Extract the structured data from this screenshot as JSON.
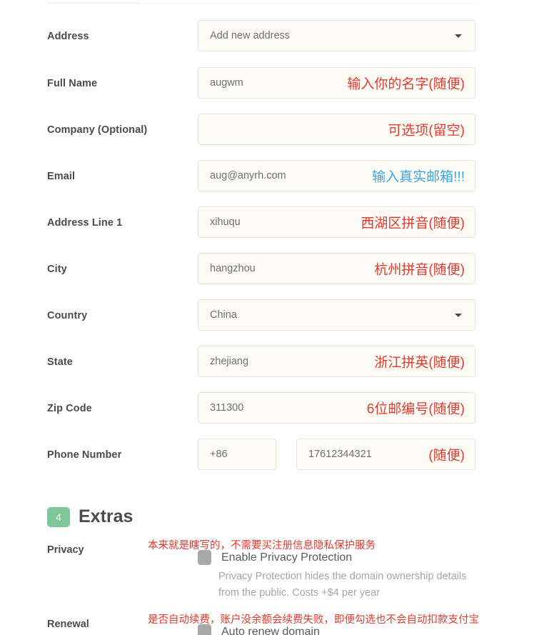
{
  "form": {
    "rows": [
      {
        "label": "Address",
        "type": "select",
        "value": "Add new address",
        "annotation": "",
        "annotation_color": ""
      },
      {
        "label": "Full Name",
        "type": "text",
        "value": "augwm",
        "annotation": "输入你的名字(随便)",
        "annotation_color": "#e03b2f"
      },
      {
        "label": "Company (Optional)",
        "type": "text",
        "value": "",
        "annotation": "可选项(留空)",
        "annotation_color": "#e03b2f"
      },
      {
        "label": "Email",
        "type": "text",
        "value": "aug@anyrh.com",
        "annotation": "输入真实邮箱!!!",
        "annotation_color": "#3ba7e8"
      },
      {
        "label": "Address Line 1",
        "type": "text",
        "value": "xihuqu",
        "annotation": "西湖区拼音(随便)",
        "annotation_color": "#e03b2f"
      },
      {
        "label": "City",
        "type": "text",
        "value": "hangzhou",
        "annotation": "杭州拼音(随便)",
        "annotation_color": "#e03b2f"
      },
      {
        "label": "Country",
        "type": "select",
        "value": "China",
        "annotation": "",
        "annotation_color": ""
      },
      {
        "label": "State",
        "type": "text",
        "value": "zhejiang",
        "annotation": "浙江拼英(随便)",
        "annotation_color": "#e03b2f"
      },
      {
        "label": "Zip Code",
        "type": "text",
        "value": "311300",
        "annotation": "6位邮编号(随便)",
        "annotation_color": "#e03b2f"
      }
    ],
    "phone": {
      "label": "Phone Number",
      "country_code": "+86",
      "number": "17612344321",
      "annotation": "(随便)",
      "annotation_color": "#e03b2f"
    }
  },
  "extras": {
    "badge": "4",
    "title": "Extras",
    "badge_color": "#7ec79b",
    "privacy": {
      "label": "Privacy",
      "note": "本来就是瞎写的，不需要买注册信息隐私保护服务",
      "checkbox_label": "Enable Privacy Protection",
      "help_line1": "Privacy Protection hides the domain ownership details",
      "help_line2": "from the public. Costs +$4 per year"
    },
    "renewal": {
      "label": "Renewal",
      "note": "是否自动续费，账户没余额会续费失败，即便勾选也不会自动扣款支付宝",
      "checkbox_label": "Auto renew domain"
    }
  }
}
